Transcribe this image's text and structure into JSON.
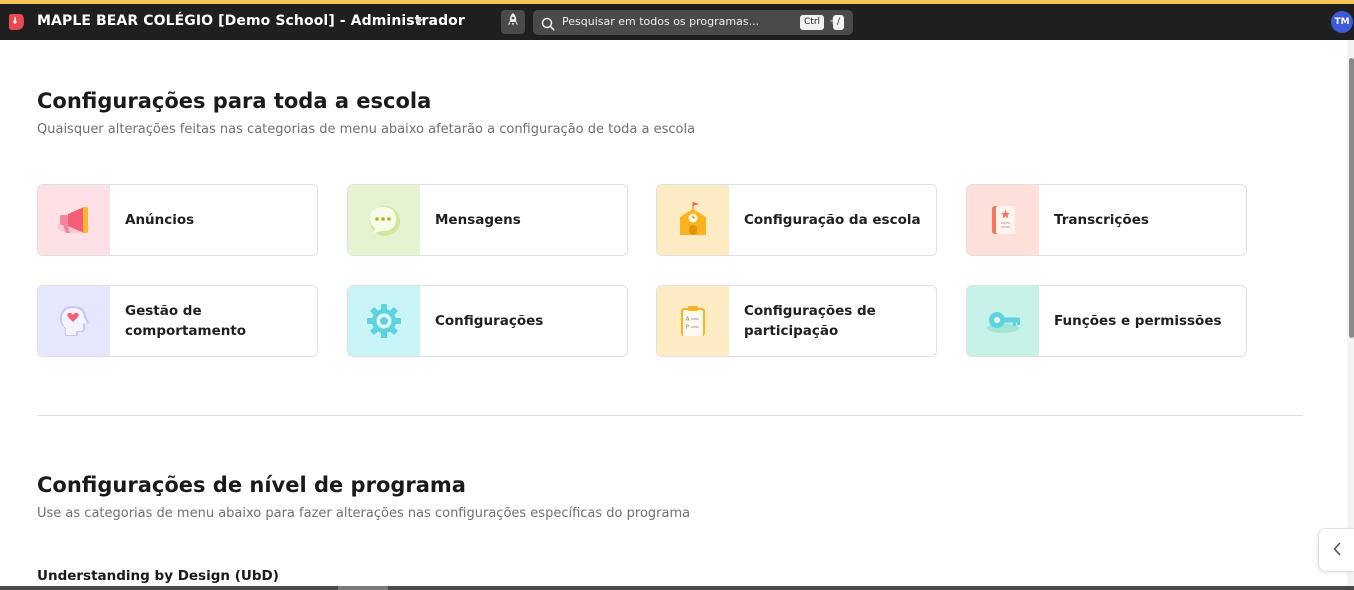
{
  "header": {
    "school_title": "MAPLE BEAR COLÉGIO [Demo School] - Administrador",
    "search_placeholder": "Pesquisar em todos os programas...",
    "shortcut_ctrl": "Ctrl",
    "shortcut_plus": "+",
    "shortcut_key": "/",
    "avatar_initials": "TM",
    "accent_color": "#f6c456"
  },
  "school_section": {
    "title": "Configurações para toda a escola",
    "subtitle": "Quaisquer alterações feitas nas categorias de menu abaixo afetarão a configuração de toda a escola",
    "cards": [
      {
        "label": "Anúncios",
        "icon": "megaphone-icon",
        "bg": "#fde1e7"
      },
      {
        "label": "Mensagens",
        "icon": "chat-bubble-icon",
        "bg": "#e6f3d0"
      },
      {
        "label": "Configuração da escola",
        "icon": "school-building-icon",
        "bg": "#fdebc4"
      },
      {
        "label": "Transcrições",
        "icon": "transcript-book-icon",
        "bg": "#fde0d9"
      },
      {
        "label": "Gestão de comportamento",
        "icon": "head-heart-icon",
        "bg": "#e6e6fc"
      },
      {
        "label": "Configurações",
        "icon": "gear-icon",
        "bg": "#c8f5f7"
      },
      {
        "label": "Configurações de participação",
        "icon": "attendance-clipboard-icon",
        "bg": "#fdebc4"
      },
      {
        "label": "Funções e permissões",
        "icon": "key-icon",
        "bg": "#c6f2e9"
      }
    ]
  },
  "program_section": {
    "title": "Configurações de nível de programa",
    "subtitle": "Use as categorias de menu abaixo para fazer alterações nas configurações específicas do programa",
    "program_name": "Understanding by Design (UbD)"
  }
}
